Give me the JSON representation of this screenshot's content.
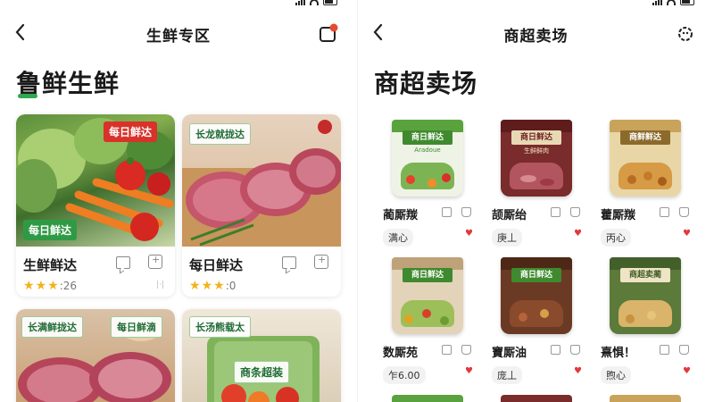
{
  "colors": {
    "accent_green": "#2fa84f",
    "tag_red": "#d8322b",
    "tag_green": "#2f9a45",
    "star": "#f2b21c",
    "heart": "#e0393e"
  },
  "left_screen": {
    "nav": {
      "back_icon": "chevron-left-icon",
      "title": "生鲜专区",
      "right_icon": "notification-bell-icon"
    },
    "heading": "鲁鲜生鲜",
    "cards": [
      {
        "photo": "vegetables",
        "tag_top": "每日鲜达",
        "tag_bottom": "每日鲜达",
        "name": "生鲜鲜达",
        "rating": 2.5,
        "rating_text": ":26",
        "mini": "|·|"
      },
      {
        "photo": "pork",
        "tag_top": "长龙就拢达",
        "tag_bottom": "",
        "name": "每日鲜达",
        "rating": 2.5,
        "rating_text": ":0",
        "mini": ""
      },
      {
        "photo": "steak",
        "tag_top": "长满鲜拢达",
        "tag_bottom": "",
        "tag_right": "每日鲜滴",
        "name": "",
        "rating": 0,
        "rating_text": ""
      },
      {
        "photo": "packaged",
        "tag_top": "长汤熊载太",
        "tag_mid": "商条超装",
        "name": "",
        "rating": 0,
        "rating_text": ""
      }
    ]
  },
  "right_screen": {
    "nav": {
      "back_icon": "chevron-left-icon",
      "title": "商超卖场",
      "right_icon": "settings-cog-icon"
    },
    "heading": "商超卖场",
    "products": [
      {
        "label": "商日鲜达",
        "sub": "Aradoue",
        "title": "蔺厮羰",
        "price": "满心",
        "theme": "green"
      },
      {
        "label": "商日鲜达",
        "sub": "生鲜鲜肉",
        "title": "颉厮绐",
        "price": "庚丄",
        "theme": "maroon"
      },
      {
        "label": "商鲜鲜达",
        "sub": "",
        "title": "藿厮羰",
        "price": "丙心",
        "theme": "tan"
      },
      {
        "label": "商日鲜达",
        "sub": "",
        "title": "数厮苑",
        "price": "乍6.00",
        "theme": "kraft"
      },
      {
        "label": "商日鲜达",
        "sub": "",
        "title": "寶厮油",
        "price": "庞丄",
        "theme": "brown"
      },
      {
        "label": "商超卖蔺",
        "sub": "",
        "title": "熹惧！",
        "price": "煦心",
        "theme": "olive"
      }
    ]
  }
}
